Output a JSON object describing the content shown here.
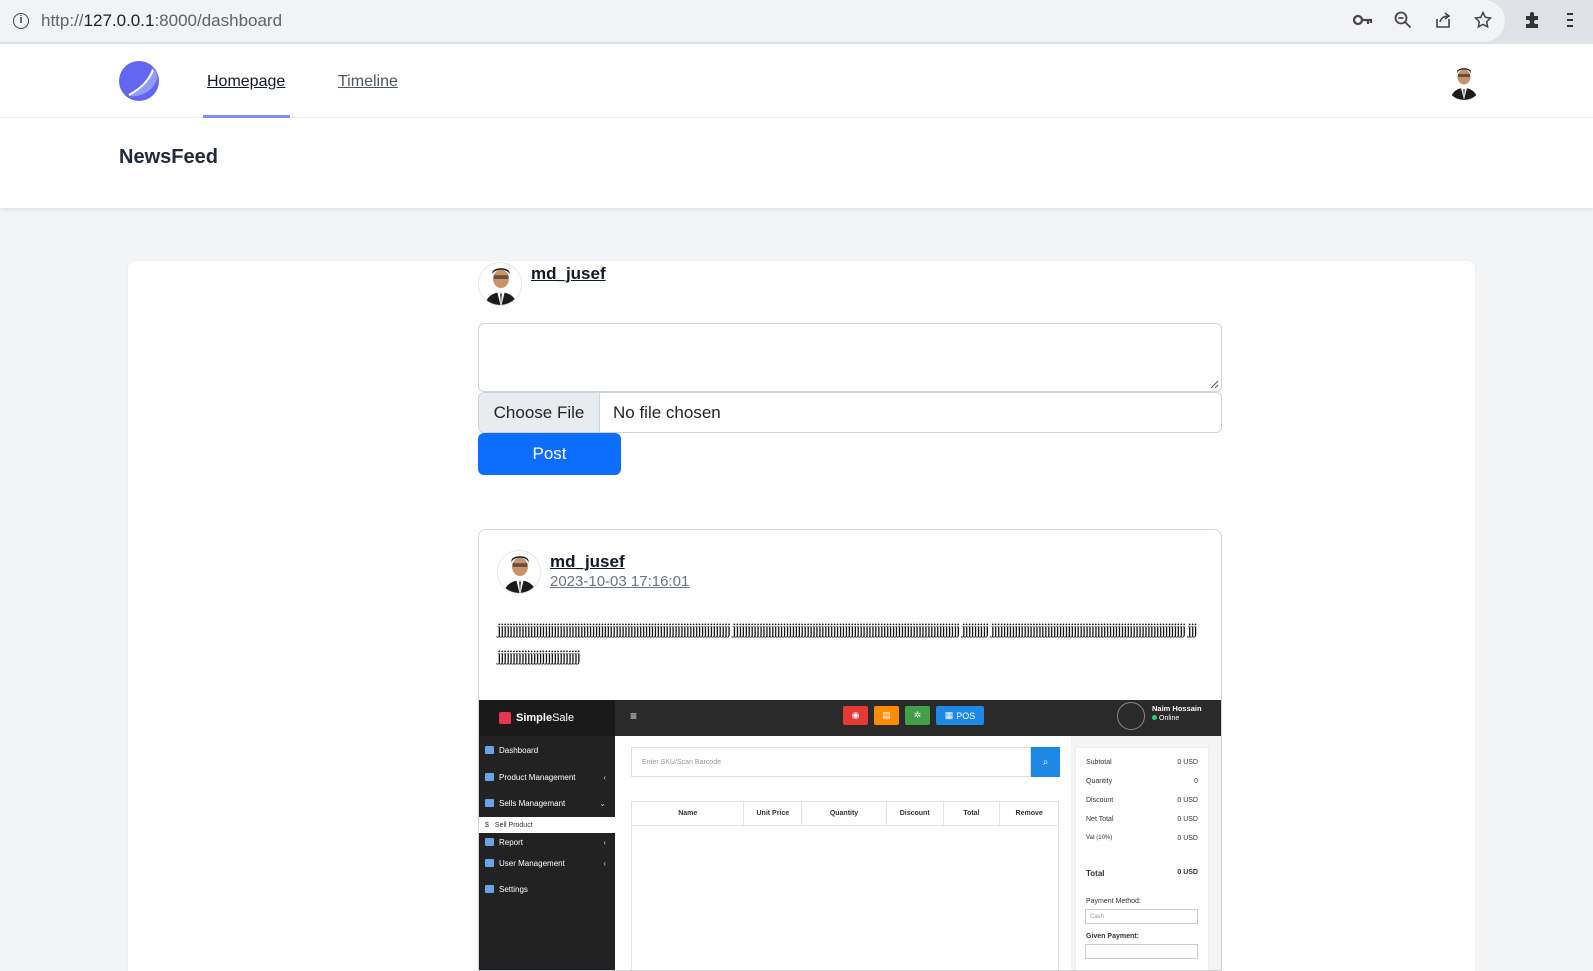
{
  "browser": {
    "url_scheme": "http://",
    "url_host": "127.0.0.1",
    "url_rest": ":8000/dashboard"
  },
  "nav": {
    "links": [
      "Homepage",
      "Timeline"
    ],
    "active_color": "#818cf8"
  },
  "header": {
    "title": "NewsFeed"
  },
  "composer": {
    "username": "md_jusef",
    "textarea_value": "",
    "file_button": "Choose File",
    "file_status": "No file chosen",
    "post_label": "Post",
    "post_color": "#0d6efd"
  },
  "post": {
    "username": "md_jusef",
    "timestamp": "2023-10-03 17:16:01",
    "text": "jjjjjjjjjjjjjjjjjjjjjjjjjjjjjjjjjjjjjjjjjjjjjjjjjjjjjjjjjjjjjjjjjjjjjjjjjjjjjjj jjjjjjjjjjjjjjjjjjjjjjjjjjjjjjjjjjjjjjjjjjjjjjjjjjjjjjjjjjjjjjjjjjjjjjjjjjjjj jjjjjjjjj jjjjjjjjjjjjjjjjjjjjjjjjjjjjjjjjjjjjjjjjjjjjjjjjjjjjjjjjjjjjjjjjjj jjjjjjjjjjjjjjjjjjjjjjjjjjjjjjj",
    "image": {
      "brand_a": "Simple",
      "brand_b": "Sale",
      "sidebar": [
        "Dashboard",
        "Product Management",
        "Sells Managemant",
        "Report",
        "User Management",
        "Settings"
      ],
      "sidebar_sub": "Sell Product",
      "pos_label": "POS",
      "user_name": "Naim Hossain",
      "user_status": "Online",
      "sku_placeholder": "Enter SKU/Scan Barcode",
      "columns": [
        "Name",
        "Unit Price",
        "Quantity",
        "Discount",
        "Total",
        "Remove"
      ],
      "summary": [
        {
          "label": "Subtotal",
          "value": "0 USD"
        },
        {
          "label": "Quantity",
          "value": "0"
        },
        {
          "label": "Discount",
          "value": "0 USD"
        },
        {
          "label": "Net Total",
          "value": "0 USD"
        },
        {
          "label": "Vat (10%)",
          "value": "0 USD"
        }
      ],
      "total_label": "Total",
      "total_value": "0 USD",
      "payment_method_label": "Payment Method:",
      "payment_method_value": "Cash",
      "given_payment_label": "Given Payment:"
    }
  }
}
